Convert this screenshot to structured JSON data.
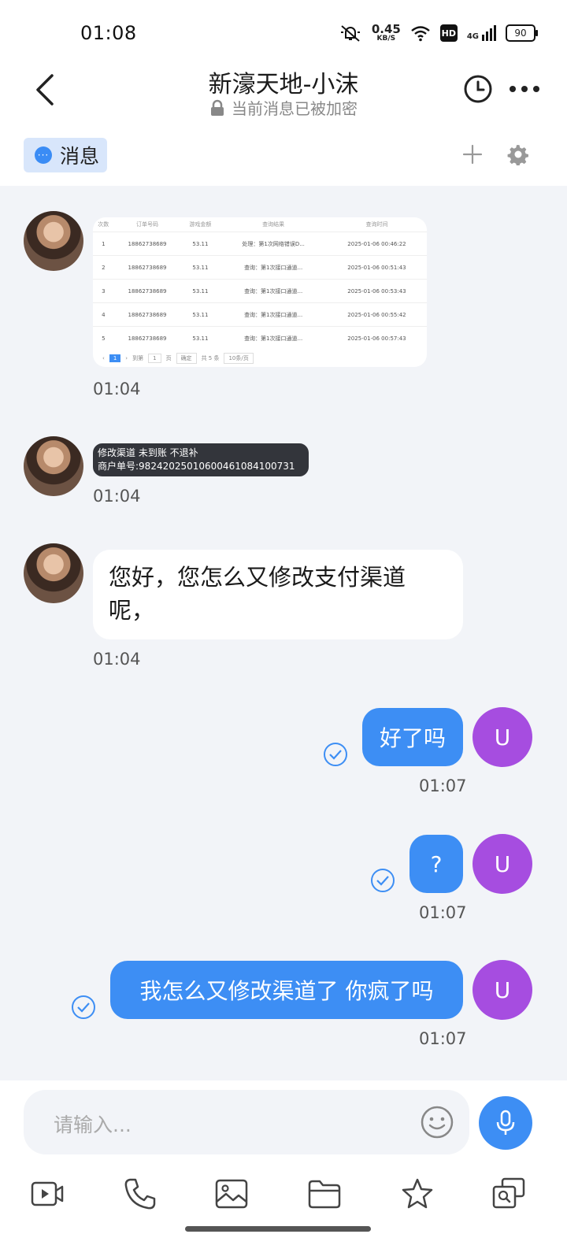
{
  "status_bar": {
    "time": "01:08",
    "speed_value": "0.45",
    "speed_unit": "KB/S",
    "hd": "HD",
    "network": "4G",
    "battery": "90"
  },
  "header": {
    "title": "新濠天地-小沫",
    "subtitle": "当前消息已被加密"
  },
  "tab_bar": {
    "tab_label": "消息"
  },
  "messages": [
    {
      "side": "incoming",
      "kind": "image",
      "time": "01:04",
      "table": {
        "headers": [
          "次数",
          "订单号码",
          "游戏金额",
          "查询结果",
          "查询时间"
        ],
        "rows": [
          [
            "1",
            "18862738689",
            "53.11",
            "处理：第1次网络错误D...",
            "2025-01-06 00:46:22"
          ],
          [
            "2",
            "18862738689",
            "53.11",
            "查询：第1次接口通道...",
            "2025-01-06 00:51:43"
          ],
          [
            "3",
            "18862738689",
            "53.11",
            "查询：第1次接口通道...",
            "2025-01-06 00:53:43"
          ],
          [
            "4",
            "18862738689",
            "53.11",
            "查询：第1次接口通道...",
            "2025-01-06 00:55:42"
          ],
          [
            "5",
            "18862738689",
            "53.11",
            "查询：第1次接口通道...",
            "2025-01-06 00:57:43"
          ]
        ],
        "pager": {
          "prev": "‹",
          "current": "1",
          "next": "›",
          "goto": "到第",
          "page_input": "1",
          "page_unit": "页",
          "confirm": "确定",
          "total": "共 5 条",
          "per_page": "10条/页"
        }
      }
    },
    {
      "side": "incoming",
      "kind": "image-text",
      "time": "01:04",
      "line1": "修改渠道  未到账 不退补",
      "line2": "商户单号:98242025010600461084100731"
    },
    {
      "side": "incoming",
      "kind": "text",
      "time": "01:04",
      "text": "您好，您怎么又修改支付渠道呢，"
    },
    {
      "side": "outgoing",
      "kind": "text",
      "time": "01:07",
      "text": "好了吗",
      "avatar": "U"
    },
    {
      "side": "outgoing",
      "kind": "text",
      "time": "01:07",
      "text": "?",
      "avatar": "U"
    },
    {
      "side": "outgoing",
      "kind": "text",
      "time": "01:07",
      "text": "我怎么又修改渠道了 你疯了吗",
      "avatar": "U"
    }
  ],
  "composer": {
    "placeholder": "请输入..."
  },
  "toolbar_icons": [
    "video-icon",
    "phone-icon",
    "image-icon",
    "folder-icon",
    "star-icon",
    "search-chat-icon"
  ],
  "colors": {
    "accent": "#3d8ef4",
    "user_avatar": "#a64de0",
    "chat_bg": "#f2f4f8"
  }
}
